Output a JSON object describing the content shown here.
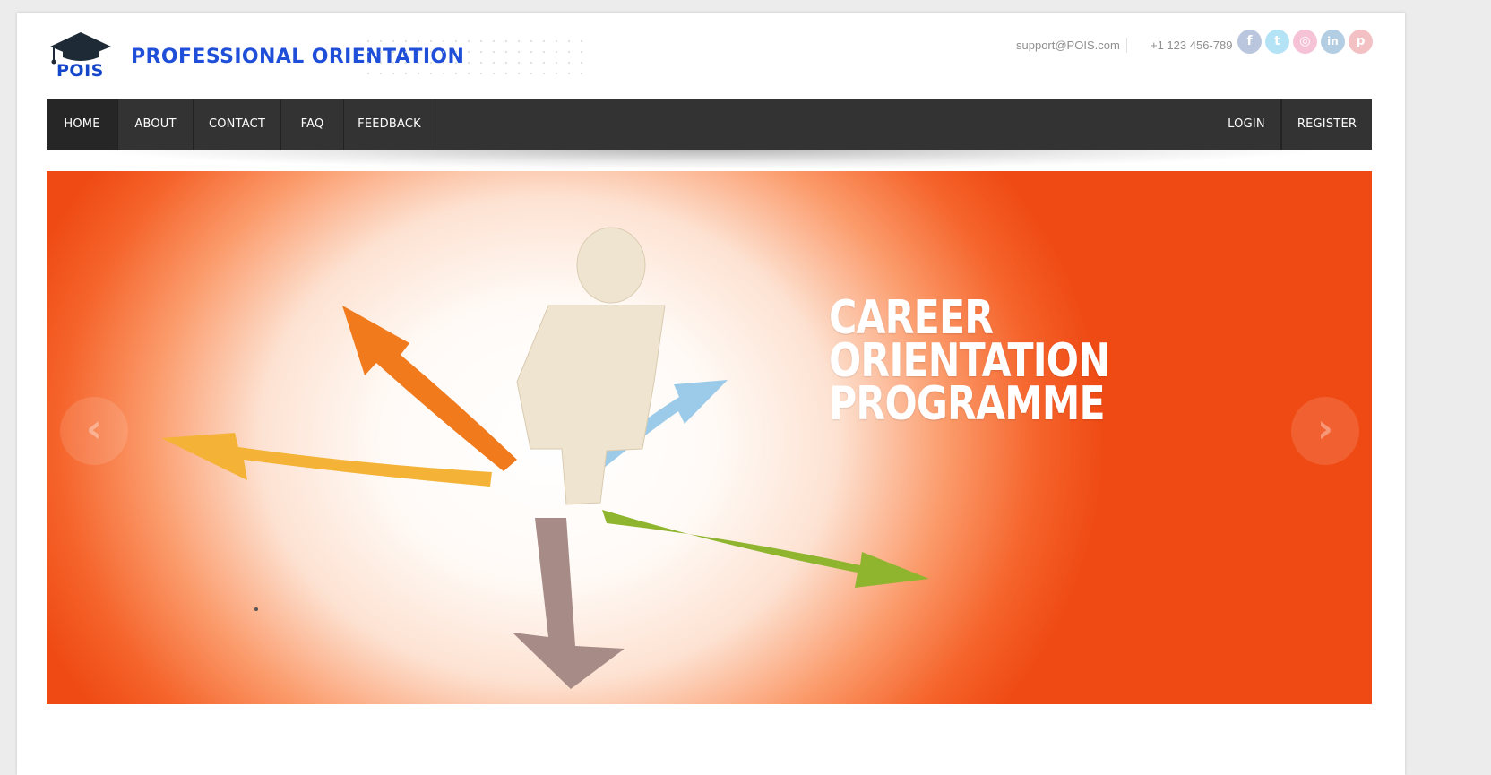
{
  "brand": {
    "logo_text": "POIS",
    "site_title": "PROFESSIONAL ORIENTATION"
  },
  "contact": {
    "email": "support@POIS.com",
    "phone": "+1 123 456-789"
  },
  "social": [
    {
      "icon": "facebook-icon",
      "glyph": "f",
      "color": "#b9c6de"
    },
    {
      "icon": "twitter-icon",
      "glyph": "t",
      "color": "#b4e3f5"
    },
    {
      "icon": "dribbble-icon",
      "glyph": "◎",
      "color": "#f6c3d6"
    },
    {
      "icon": "linkedin-icon",
      "glyph": "in",
      "color": "#b3cde3"
    },
    {
      "icon": "pinterest-icon",
      "glyph": "p",
      "color": "#f3c1c4"
    }
  ],
  "nav": {
    "home": "HOME",
    "about": "ABOUT",
    "contact": "CONTACT",
    "faq": "FAQ",
    "feedback": "FEEDBACK",
    "login": "LOGIN",
    "register": "REGISTER"
  },
  "slider": {
    "headline_line1": "CAREER",
    "headline_line2": "ORIENTATION",
    "headline_line3": "PROGRAMME",
    "prev_glyph": "‹",
    "next_glyph": "›"
  },
  "colors": {
    "brand_blue": "#1f4fd8",
    "nav_bg": "#333333",
    "slide_orange": "#ef4a14"
  }
}
